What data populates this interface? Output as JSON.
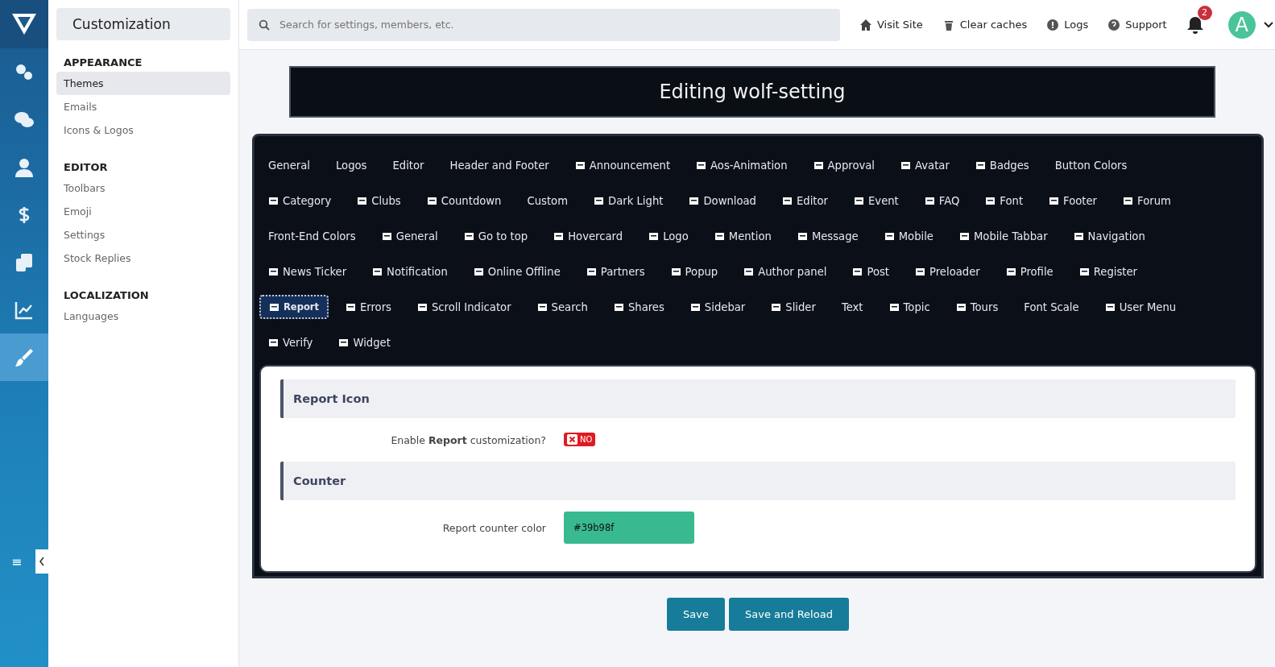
{
  "rail": {
    "items": [
      {
        "selected": false
      },
      {
        "selected": false
      },
      {
        "selected": false
      },
      {
        "selected": false
      },
      {
        "selected": false
      },
      {
        "selected": false
      },
      {
        "selected": true
      }
    ],
    "toggle": "≡"
  },
  "sidebar": {
    "title": "Customization",
    "sections": [
      {
        "heading": "APPEARANCE",
        "items": [
          {
            "label": "Themes",
            "selected": true
          },
          {
            "label": "Emails",
            "selected": false
          },
          {
            "label": "Icons & Logos",
            "selected": false
          }
        ]
      },
      {
        "heading": "EDITOR",
        "items": [
          {
            "label": "Toolbars",
            "selected": false
          },
          {
            "label": "Emoji",
            "selected": false
          },
          {
            "label": "Settings",
            "selected": false
          },
          {
            "label": "Stock Replies",
            "selected": false
          }
        ]
      },
      {
        "heading": "LOCALIZATION",
        "items": [
          {
            "label": "Languages",
            "selected": false
          }
        ]
      }
    ]
  },
  "topbar": {
    "search": {
      "placeholder": "Search for settings, members, etc."
    },
    "links": [
      "Visit Site",
      "Clear caches",
      "Logs",
      "Support"
    ],
    "notifications": "2",
    "avatar": "A"
  },
  "title": "Editing wolf-setting",
  "tab_rows": [
    [
      {
        "label": "General",
        "icon": false,
        "selected": false
      },
      {
        "label": "Logos",
        "icon": false,
        "selected": false
      },
      {
        "label": "Editor",
        "icon": false,
        "selected": false
      },
      {
        "label": "Header and Footer",
        "icon": false,
        "selected": false
      },
      {
        "label": "Announcement",
        "icon": true,
        "selected": false
      },
      {
        "label": "Aos-Animation",
        "icon": true,
        "selected": false
      },
      {
        "label": "Approval",
        "icon": true,
        "selected": false
      },
      {
        "label": "Avatar",
        "icon": true,
        "selected": false
      },
      {
        "label": "Badges",
        "icon": true,
        "selected": false
      },
      {
        "label": "Button Colors",
        "icon": false,
        "selected": false
      }
    ],
    [
      {
        "label": "Category",
        "icon": true,
        "selected": false
      },
      {
        "label": "Clubs",
        "icon": true,
        "selected": false
      },
      {
        "label": "Countdown",
        "icon": true,
        "selected": false
      },
      {
        "label": "Custom",
        "icon": false,
        "selected": false
      },
      {
        "label": "Dark Light",
        "icon": true,
        "selected": false
      },
      {
        "label": "Download",
        "icon": true,
        "selected": false
      },
      {
        "label": "Editor",
        "icon": true,
        "selected": false
      },
      {
        "label": "Event",
        "icon": true,
        "selected": false
      },
      {
        "label": "FAQ",
        "icon": true,
        "selected": false
      },
      {
        "label": "Font",
        "icon": true,
        "selected": false
      },
      {
        "label": "Footer",
        "icon": true,
        "selected": false
      },
      {
        "label": "Forum",
        "icon": true,
        "selected": false
      }
    ],
    [
      {
        "label": "Front-End Colors",
        "icon": false,
        "selected": false
      },
      {
        "label": "General",
        "icon": true,
        "selected": false
      },
      {
        "label": "Go to top",
        "icon": true,
        "selected": false
      },
      {
        "label": "Hovercard",
        "icon": true,
        "selected": false
      },
      {
        "label": "Logo",
        "icon": true,
        "selected": false
      },
      {
        "label": "Mention",
        "icon": true,
        "selected": false
      },
      {
        "label": "Message",
        "icon": true,
        "selected": false
      },
      {
        "label": "Mobile",
        "icon": true,
        "selected": false
      },
      {
        "label": "Mobile Tabbar",
        "icon": true,
        "selected": false
      },
      {
        "label": "Navigation",
        "icon": true,
        "selected": false
      }
    ],
    [
      {
        "label": "News Ticker",
        "icon": true,
        "selected": false
      },
      {
        "label": "Notification",
        "icon": true,
        "selected": false
      },
      {
        "label": "Online Offline",
        "icon": true,
        "selected": false
      },
      {
        "label": "Partners",
        "icon": true,
        "selected": false
      },
      {
        "label": "Popup",
        "icon": true,
        "selected": false
      },
      {
        "label": "Author panel",
        "icon": true,
        "selected": false
      },
      {
        "label": "Post",
        "icon": true,
        "selected": false
      },
      {
        "label": "Preloader",
        "icon": true,
        "selected": false
      },
      {
        "label": "Profile",
        "icon": true,
        "selected": false
      },
      {
        "label": "Register",
        "icon": true,
        "selected": false
      }
    ],
    [
      {
        "label": "Report",
        "icon": true,
        "selected": true
      },
      {
        "label": "Errors",
        "icon": true,
        "selected": false
      },
      {
        "label": "Scroll Indicator",
        "icon": true,
        "selected": false
      },
      {
        "label": "Search",
        "icon": true,
        "selected": false
      },
      {
        "label": "Shares",
        "icon": true,
        "selected": false
      },
      {
        "label": "Sidebar",
        "icon": true,
        "selected": false
      },
      {
        "label": "Slider",
        "icon": true,
        "selected": false
      },
      {
        "label": "Text",
        "icon": false,
        "selected": false
      },
      {
        "label": "Topic",
        "icon": true,
        "selected": false
      },
      {
        "label": "Tours",
        "icon": true,
        "selected": false
      },
      {
        "label": "Font Scale",
        "icon": false,
        "selected": false
      },
      {
        "label": "User Menu",
        "icon": true,
        "selected": false
      }
    ],
    [
      {
        "label": "Verify",
        "icon": true,
        "selected": false
      },
      {
        "label": "Widget",
        "icon": true,
        "selected": false
      }
    ]
  ],
  "sections": [
    {
      "heading": "Report Icon",
      "rows": [
        {
          "kind": "toggle",
          "label": "Enable **Report** customization?",
          "on": false,
          "value": "NO"
        }
      ]
    },
    {
      "heading": "Counter",
      "rows": [
        {
          "kind": "color",
          "label": "Report counter color",
          "value": "#39b98f"
        }
      ]
    }
  ],
  "buttons": [
    "Save",
    "Save and Reload"
  ]
}
